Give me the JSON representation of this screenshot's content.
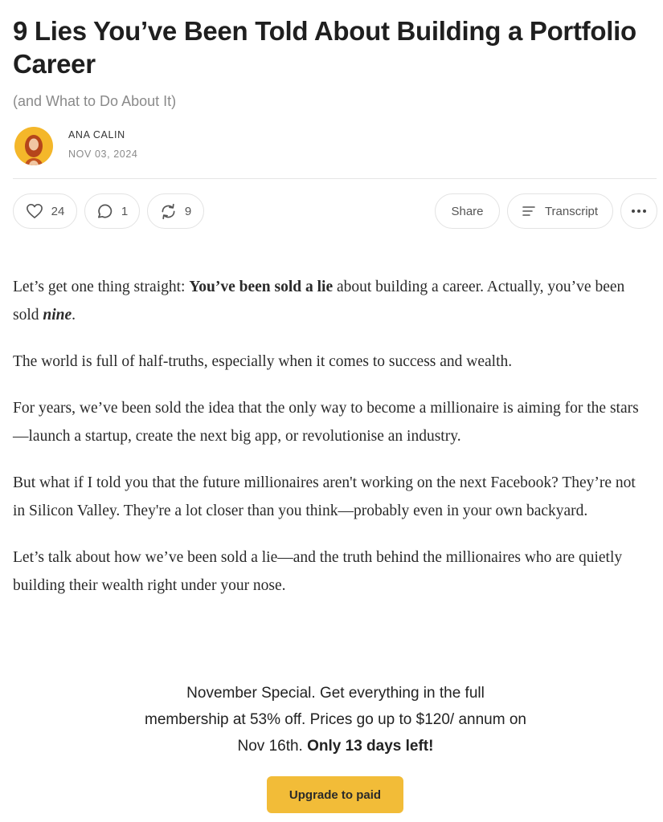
{
  "post": {
    "title": "9 Lies You’ve Been Told About Building a Portfolio Career",
    "subtitle": "(and What to Do About It)",
    "author": "ANA CALIN",
    "date": "NOV 03, 2024"
  },
  "actions": {
    "likes": "24",
    "comments": "1",
    "restacks": "9",
    "share_label": "Share",
    "transcript_label": "Transcript"
  },
  "colors": {
    "accent": "#f2bc38",
    "avatar_bg": "#f4b72a"
  },
  "icons": [
    "heart-icon",
    "comment-icon",
    "restack-icon",
    "transcript-lines-icon",
    "more-dots-icon"
  ],
  "content": {
    "p1": [
      {
        "t": "Let’s get one thing straight: ",
        "s": ""
      },
      {
        "t": "You’ve been sold a lie",
        "s": "b"
      },
      {
        "t": " about building a career. Actually, you’ve been sold ",
        "s": ""
      },
      {
        "t": "nine",
        "s": "bi"
      },
      {
        "t": ".",
        "s": ""
      }
    ],
    "p2": "The world is full of half-truths, especially when it comes to success and wealth.",
    "p3": "For years, we’ve been sold the idea that the only way to become a millionaire is aiming for the stars—launch a startup, create the next big app, or revolutionise an industry.",
    "p4": "But what if I told you that the future millionaires aren't working on the next Facebook? They’re not in Silicon Valley. They're a lot closer than you think—probably even in your own backyard.",
    "p5": "Let’s talk about how we’ve been sold a lie—and the truth behind the millionaires who are quietly building their wealth right under your nose."
  },
  "promo": {
    "text": "November Special. Get everything in the full membership at 53% off. Prices go up to $120/ annum on Nov 16th. ",
    "emphasis": "Only 13 days left!",
    "button_label": "Upgrade to paid"
  }
}
